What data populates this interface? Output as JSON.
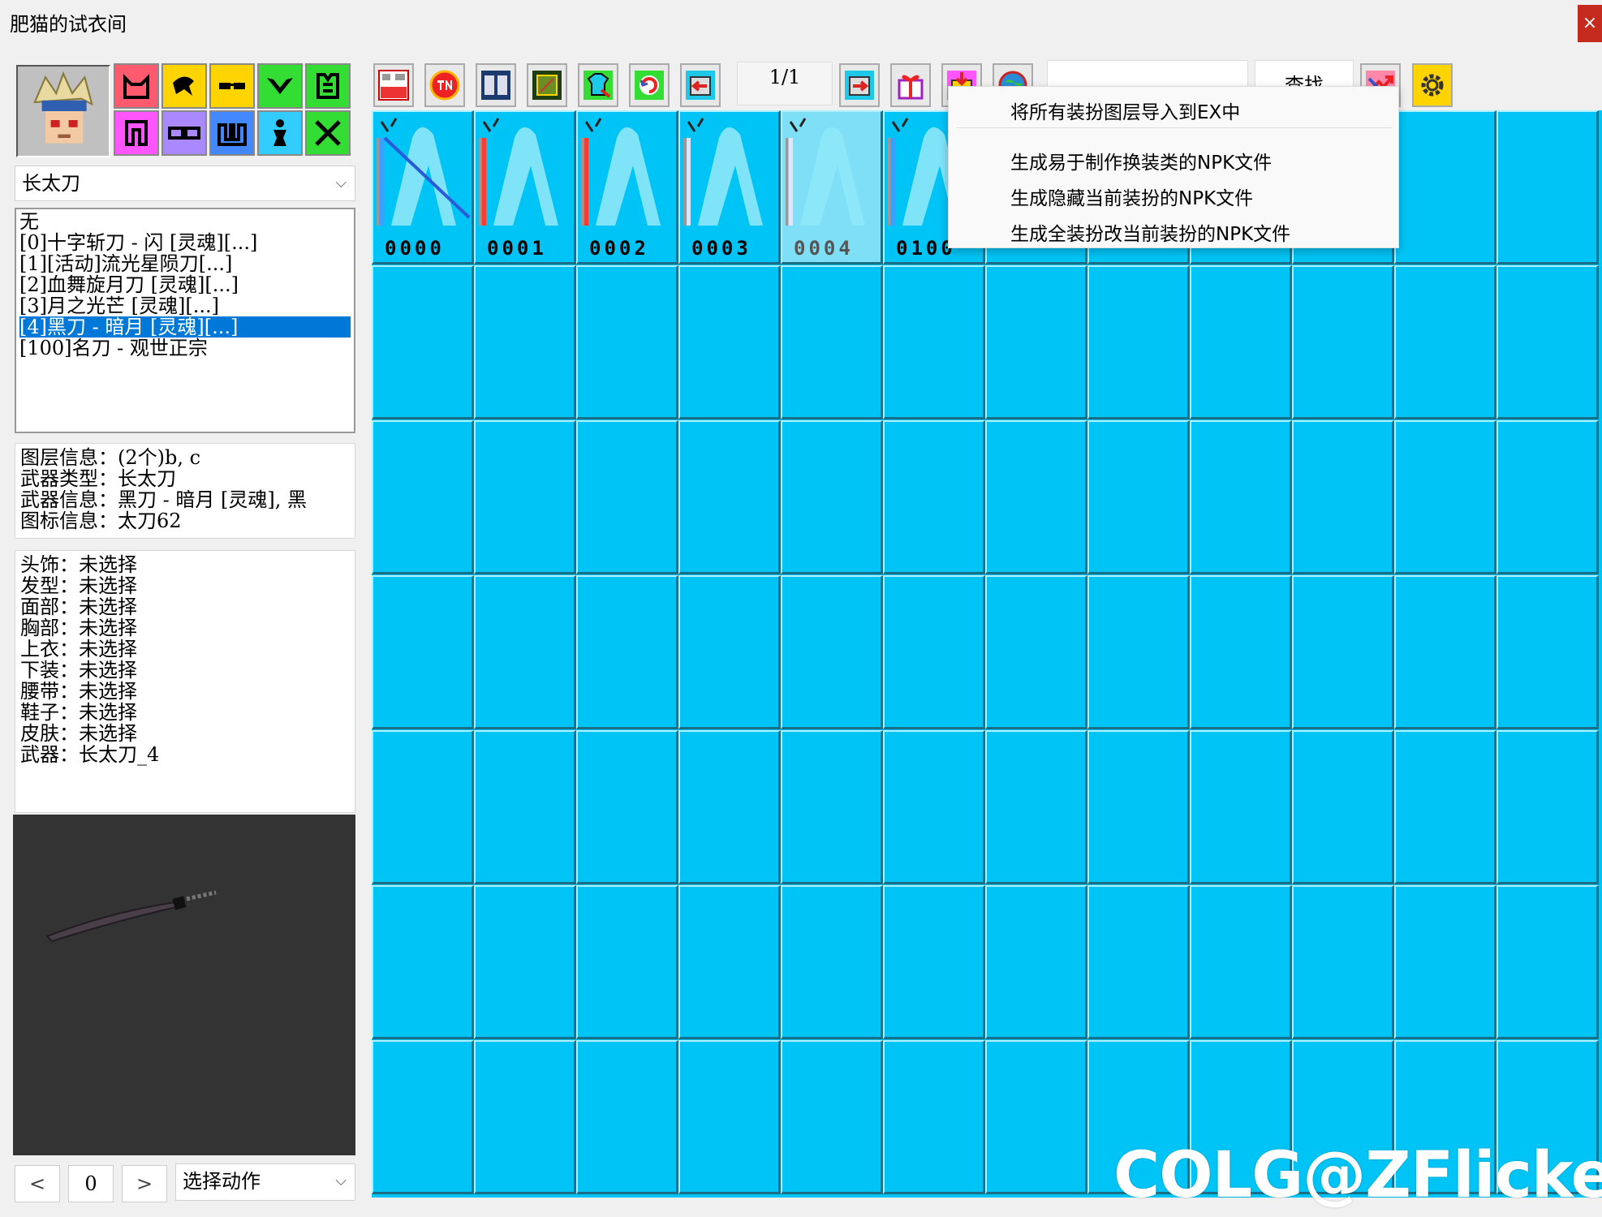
{
  "window": {
    "title": "肥猫的试衣间",
    "close_glyph": "×"
  },
  "category_select": {
    "value": "长太刀",
    "chevron": "⌵"
  },
  "weapon_list": [
    {
      "label": "无",
      "selected": false
    },
    {
      "label": "[0]十字斩刀 - 闪 [灵魂][...]",
      "selected": false
    },
    {
      "label": "[1][活动]流光星陨刀[...]",
      "selected": false
    },
    {
      "label": "[2]血舞旋月刀 [灵魂][...]",
      "selected": false
    },
    {
      "label": "[3]月之光芒 [灵魂][...]",
      "selected": false
    },
    {
      "label": "[4]黑刀 - 暗月 [灵魂][...]",
      "selected": true
    },
    {
      "label": "[100]名刀 - 观世正宗",
      "selected": false
    }
  ],
  "layer_info": {
    "layers": "图层信息：(2个)b, c",
    "weapon_type": "武器类型：长太刀",
    "weapon_info": "武器信息：黑刀 - 暗月 [灵魂], 黑",
    "icon_info": "图标信息：太刀62"
  },
  "slots": [
    "头饰：未选择",
    "发型：未选择",
    "面部：未选择",
    "胸部：未选择",
    "上衣：未选择",
    "下装：未选择",
    "腰带：未选择",
    "鞋子：未选择",
    "皮肤：未选择",
    "武器：长太刀_4"
  ],
  "frame_controls": {
    "prev": "<",
    "frame": "0",
    "next": ">",
    "action_select": "选择动作",
    "chevron": "⌵"
  },
  "toolbar": {
    "page": "1/1",
    "search_button": "查找"
  },
  "grid_items": [
    {
      "code": "0000",
      "selected": false
    },
    {
      "code": "0001",
      "selected": false
    },
    {
      "code": "0002",
      "selected": false
    },
    {
      "code": "0003",
      "selected": false
    },
    {
      "code": "0004",
      "selected": true
    },
    {
      "code": "0100",
      "selected": false
    }
  ],
  "context_menu": [
    "将所有装扮图层导入到EX中",
    "生成易于制作换装类的NPK文件",
    "生成隐藏当前装扮的NPK文件",
    "生成全装扮改当前装扮的NPK文件"
  ],
  "watermark": "COLG@ZFlicker",
  "colors": {
    "grid_bg": "#00c4f5",
    "selection": "#0078d7",
    "slot_buttons": [
      "#ff5a6e",
      "#ffd400",
      "#ffd400",
      "#33dd33",
      "#33dd33",
      "#ff55ff",
      "#aa88ff",
      "#4488ff",
      "#33ccff",
      "#33dd33"
    ]
  }
}
